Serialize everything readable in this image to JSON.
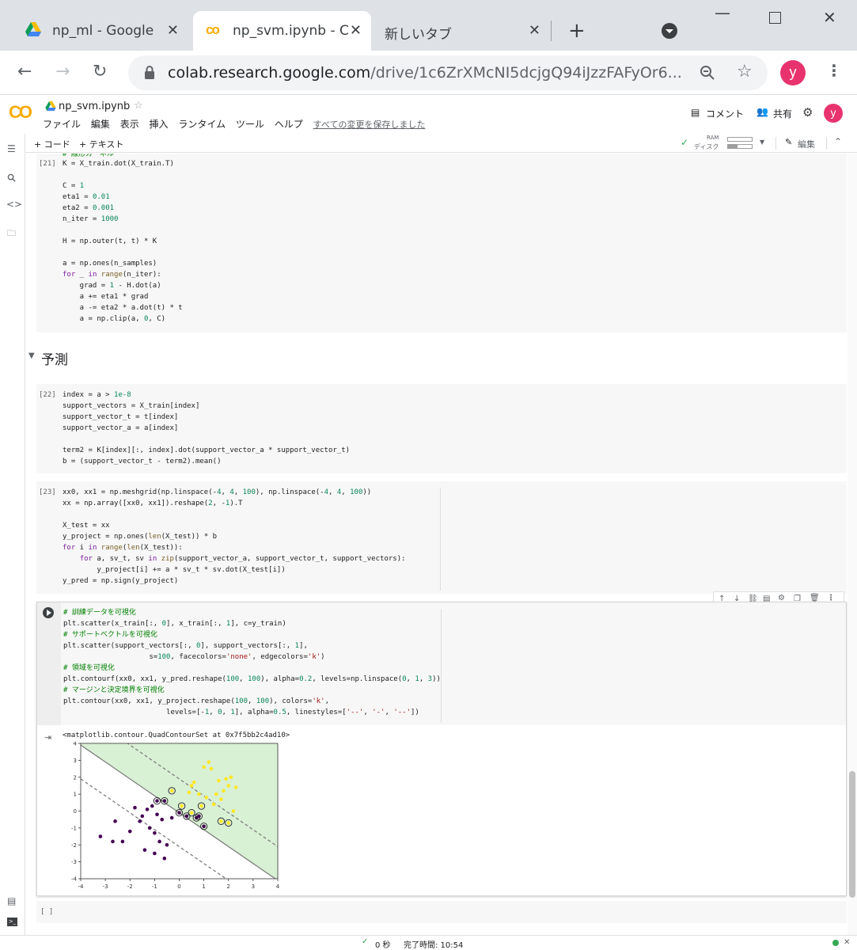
{
  "browser": {
    "tabs": [
      {
        "title": "np_ml - Google",
        "icon": "google-drive-icon"
      },
      {
        "title": "np_svm.ipynb - C",
        "icon": "colab-icon"
      },
      {
        "title": "新しいタブ",
        "icon": ""
      }
    ],
    "url_main": "colab.research.google.com",
    "url_rest": "/drive/1c6ZrXMcNI5dcjgQ94iJzzFAFyOr6...",
    "avatar_letter": "y"
  },
  "colab": {
    "logo": "CO",
    "filename": "np_svm.ipynb",
    "menu": [
      "ファイル",
      "編集",
      "表示",
      "挿入",
      "ランタイム",
      "ツール",
      "ヘルプ"
    ],
    "saved_status": "すべての変更を保存しました",
    "comment_label": "コメント",
    "share_label": "共有",
    "add_code": "+ コード",
    "add_text": "+ テキスト",
    "ram_label": "RAM",
    "disk_label": "ディスク",
    "edit_label": "編集"
  },
  "notebook": {
    "cell21_prompt": "[21]",
    "cell21_partial": "# 線形カーネル",
    "section_title": "予測",
    "cell22_prompt": "[22]",
    "cell23_prompt": "[23]",
    "output_text": "<matplotlib.contour.QuadContourSet at 0x7f5bb2c4ad10>",
    "empty_prompt": "[ ]"
  },
  "plot": {
    "x_ticks": [
      "-4",
      "-3",
      "-2",
      "-1",
      "0",
      "1",
      "2",
      "3",
      "4"
    ],
    "y_ticks": [
      "4",
      "3",
      "2",
      "1",
      "0",
      "-1",
      "-2",
      "-3",
      "-4"
    ]
  },
  "chart_data": {
    "type": "scatter",
    "xlim": [
      -4,
      4
    ],
    "ylim": [
      -4,
      4
    ],
    "x_ticks": [
      -4,
      -3,
      -2,
      -1,
      0,
      1,
      2,
      3,
      4
    ],
    "y_ticks": [
      -4,
      -3,
      -2,
      -1,
      0,
      1,
      2,
      3,
      4
    ],
    "decision_boundary": {
      "slope": -1,
      "intercept": -0.1
    },
    "margins": [
      {
        "slope": -1,
        "intercept": 1.9
      },
      {
        "slope": -1,
        "intercept": -2.1
      }
    ],
    "class_pos_color": "#fde725",
    "class_neg_color": "#440154",
    "region_pos_color": "#d8f0d4",
    "series": [
      {
        "name": "",
        "color": "#fde725",
        "x": [
          1.2,
          1.3,
          1.0,
          1.6,
          1.9,
          2.1,
          2.0,
          2.3,
          1.8,
          0.6,
          0.5,
          0.4,
          0.8,
          1.1,
          1.5,
          1.7,
          1.4,
          2.2
        ],
        "y": [
          2.9,
          2.5,
          2.6,
          1.8,
          1.9,
          2.0,
          1.5,
          1.4,
          1.2,
          1.7,
          1.5,
          1.1,
          1.0,
          0.8,
          1.0,
          0.7,
          0.4,
          0.0
        ]
      },
      {
        "name": "",
        "color": "#440154",
        "x": [
          -3.2,
          -2.7,
          -2.3,
          -2.0,
          -2.6,
          -1.2,
          -1.0,
          -0.8,
          -1.5,
          -1.3,
          -1.1,
          -0.9,
          -0.7,
          -1.6,
          -1.8,
          -0.5,
          -0.3,
          -1.0,
          -0.6,
          -1.4
        ],
        "y": [
          -1.5,
          -1.8,
          -1.8,
          -1.2,
          -0.6,
          -1.0,
          -1.3,
          -1.8,
          -0.3,
          0.1,
          0.3,
          -0.2,
          -0.5,
          -0.6,
          0.2,
          -2.0,
          -0.4,
          -2.5,
          -2.8,
          -2.3
        ]
      },
      {
        "name": "",
        "color": "#440154",
        "x": [
          -0.9,
          -0.6,
          0.0,
          0.3,
          0.7,
          0.8,
          1.0
        ],
        "y": [
          0.6,
          0.6,
          -0.1,
          -0.3,
          -0.4,
          -0.3,
          -0.9
        ]
      },
      {
        "name": "",
        "color": "#fde725",
        "x": [
          -0.3,
          0.1,
          0.5,
          0.9,
          1.7,
          2.0
        ],
        "y": [
          1.2,
          0.3,
          -0.1,
          0.3,
          -0.6,
          -0.7
        ]
      }
    ]
  },
  "status": {
    "check": "✓",
    "elapsed": "0 秒",
    "completed": "完了時間: 10:54"
  }
}
